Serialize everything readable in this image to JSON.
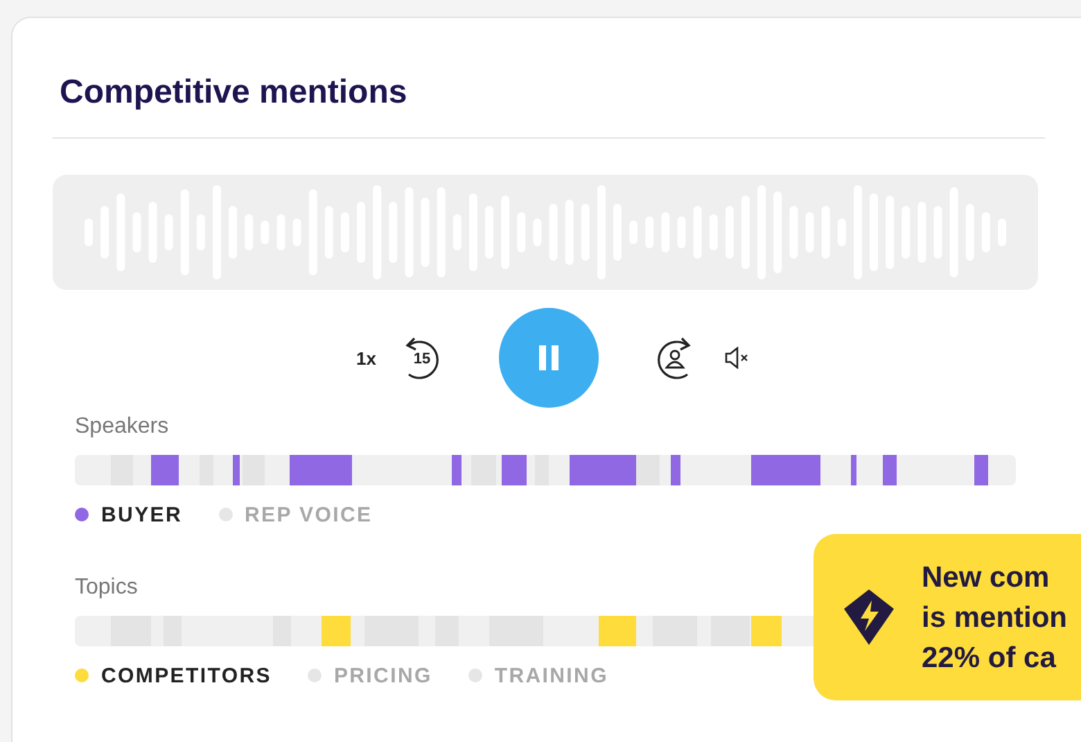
{
  "card": {
    "title": "Competitive mentions"
  },
  "player": {
    "speed": "1x",
    "rewind": "15",
    "playing": true
  },
  "speakers": {
    "label": "Speakers",
    "legend": [
      {
        "label": "BUYER",
        "selected": true,
        "color": "#9068e4"
      },
      {
        "label": "REP VOICE",
        "selected": false,
        "color": "#e6e6e6"
      }
    ]
  },
  "topics": {
    "label": "Topics",
    "legend": [
      {
        "label": "COMPETITORS",
        "selected": true,
        "color": "#fddc3c"
      },
      {
        "label": "PRICING",
        "selected": false,
        "color": "#e6e6e6"
      },
      {
        "label": "TRAINING",
        "selected": false,
        "color": "#e6e6e6"
      }
    ]
  },
  "toast": {
    "lines": [
      "New com",
      "is mention",
      "22% of ca"
    ]
  }
}
